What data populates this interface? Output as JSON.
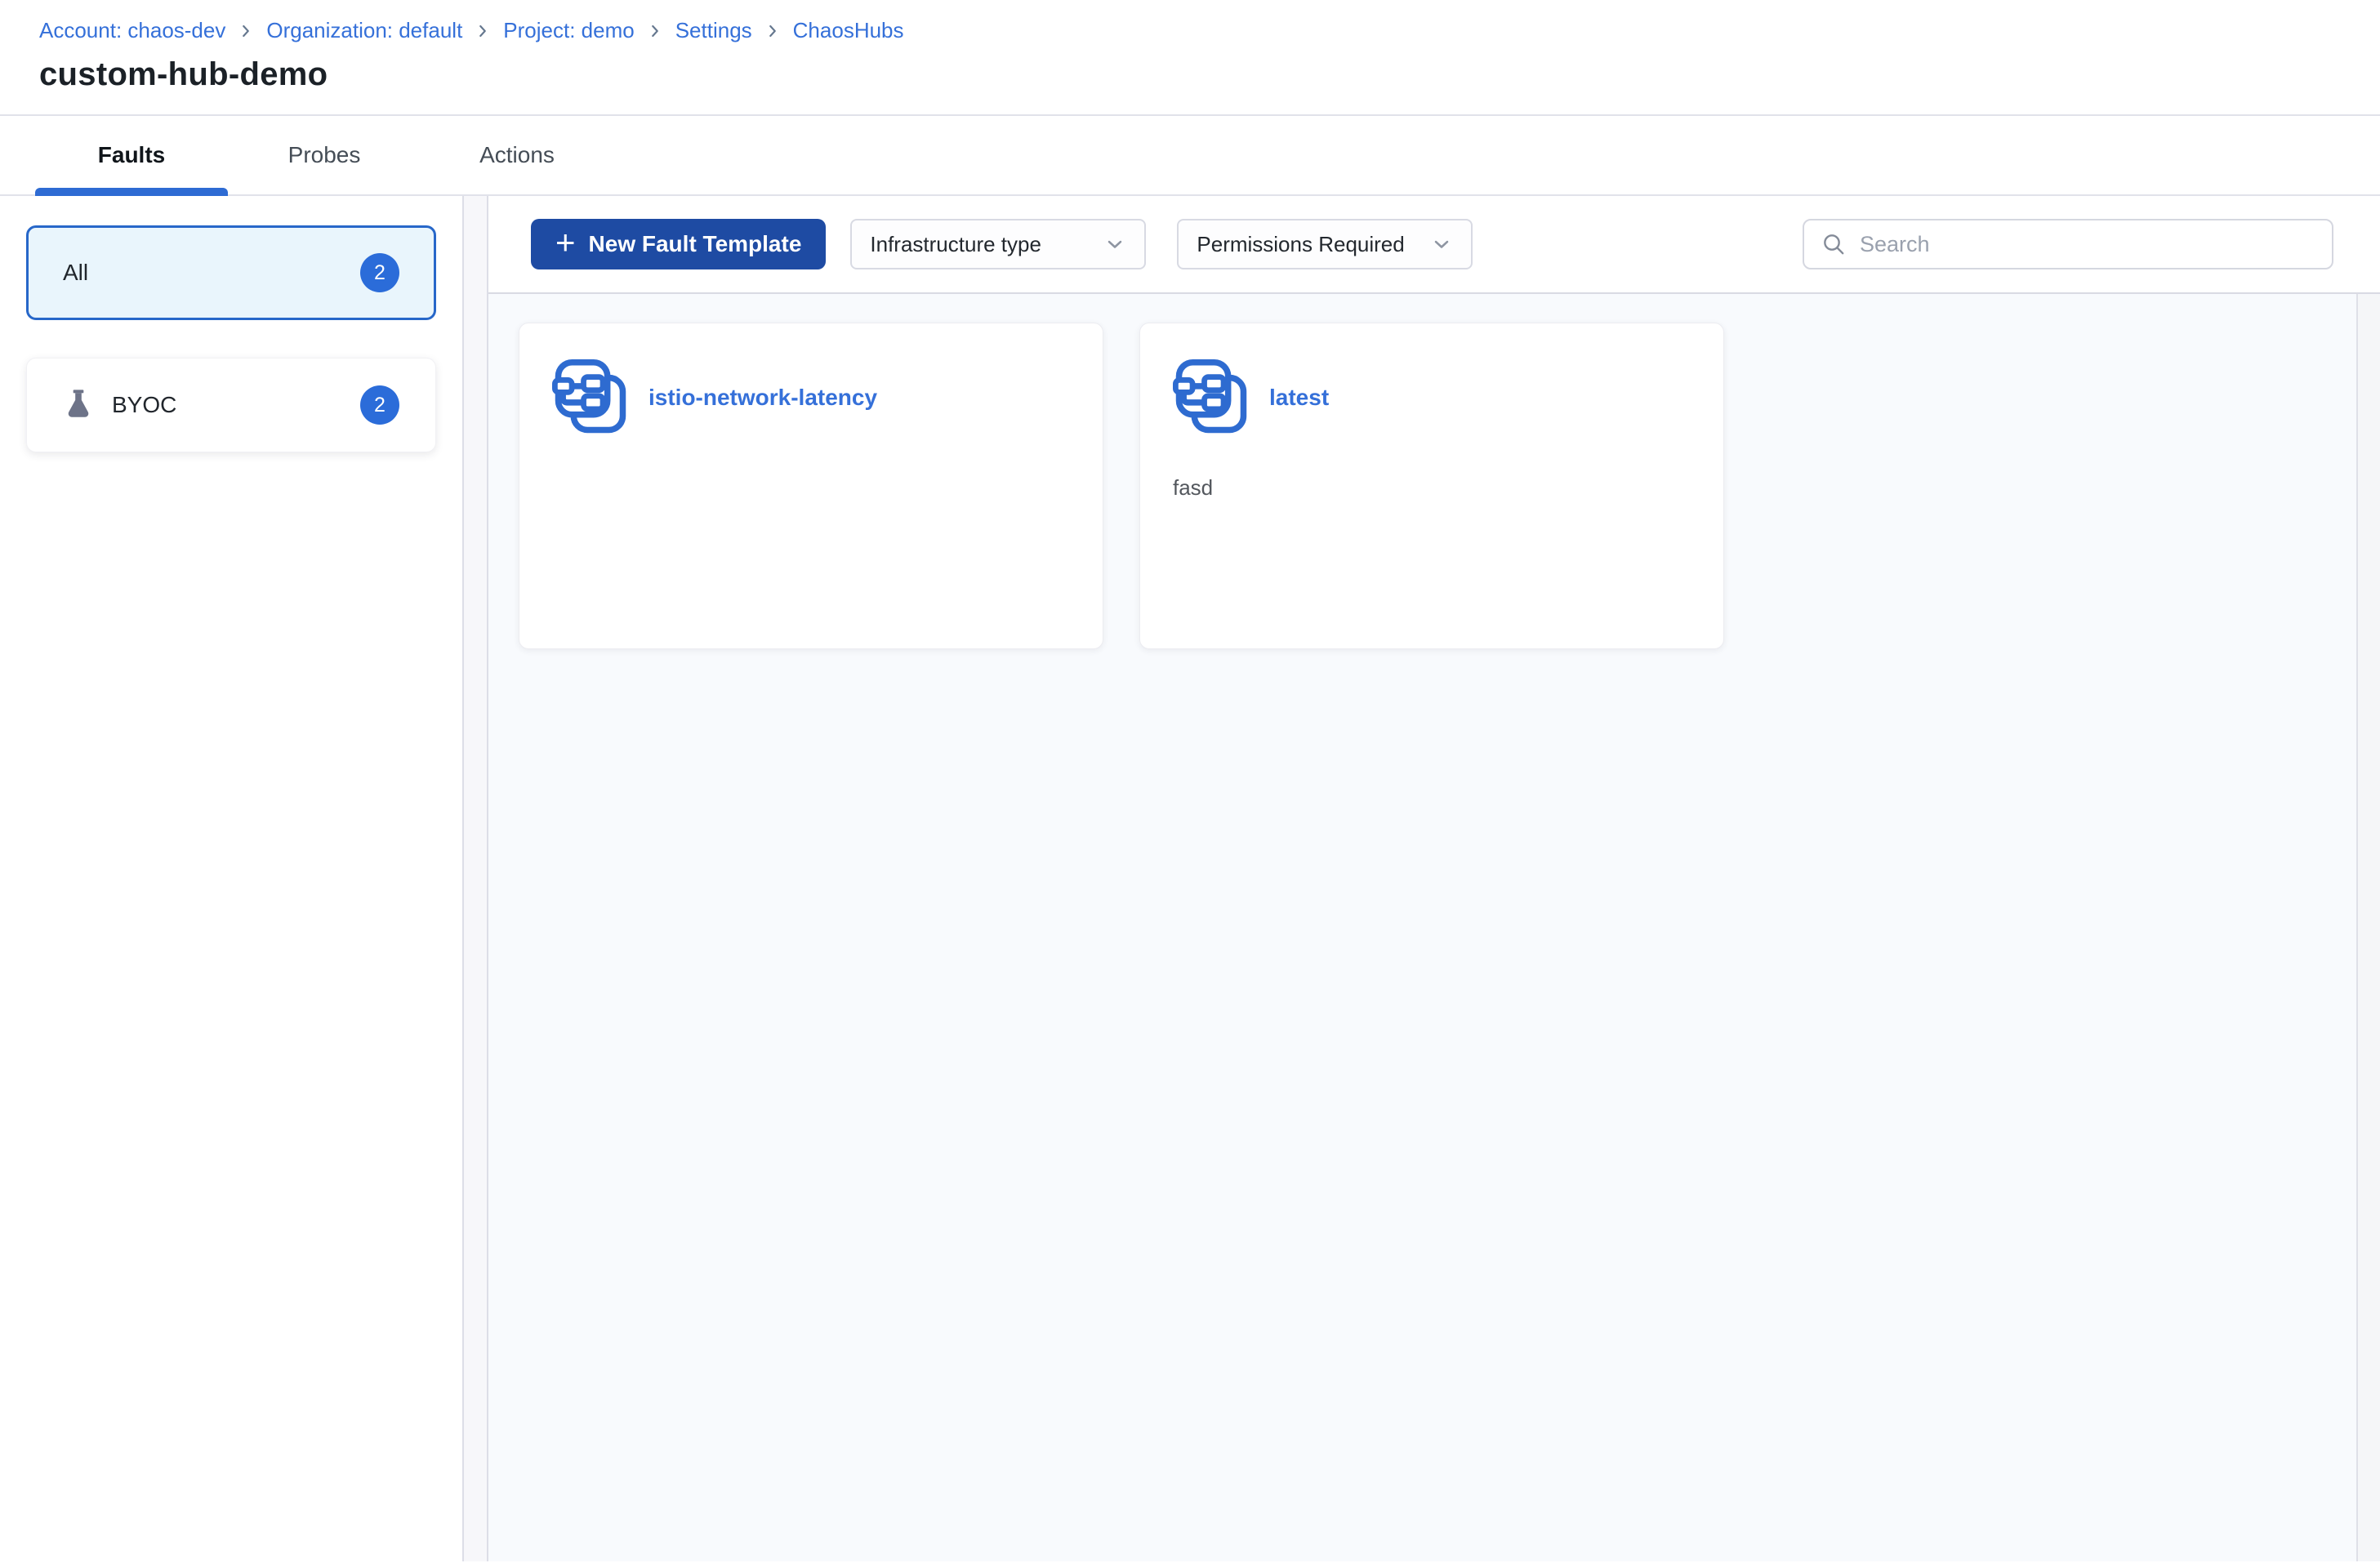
{
  "breadcrumb": {
    "items": [
      "Account: chaos-dev",
      "Organization: default",
      "Project: demo",
      "Settings",
      "ChaosHubs"
    ],
    "separator": "›"
  },
  "header": {
    "title": "custom-hub-demo"
  },
  "tabs": [
    {
      "label": "Faults",
      "active": true
    },
    {
      "label": "Probes",
      "active": false
    },
    {
      "label": "Actions",
      "active": false
    }
  ],
  "sidebar": {
    "filters": [
      {
        "label": "All",
        "count": "2",
        "selected": true,
        "icon": null
      },
      {
        "label": "BYOC",
        "count": "2",
        "selected": false,
        "icon": "flask-icon"
      }
    ]
  },
  "toolbar": {
    "new_template_button": "New Fault Template",
    "plus": "+",
    "filters": [
      {
        "label": "Infrastructure type"
      },
      {
        "label": "Permissions Required"
      }
    ],
    "search": {
      "placeholder": "Search",
      "value": ""
    }
  },
  "cards": [
    {
      "title": "istio-network-latency",
      "description": "",
      "icon": "fault-template-icon"
    },
    {
      "title": "latest",
      "description": "fasd",
      "icon": "fault-template-icon"
    }
  ],
  "colors": {
    "accent": "#2e6bd3",
    "primary_button": "#1e4ba3",
    "link": "#3570d9",
    "badge": "#2b6cd9",
    "selected_bg": "#e9f5fc",
    "selected_border": "#2767c9",
    "content_bg": "#f8fafd",
    "icon_blue": "#2e6bd0",
    "flask_gray": "#6d7388"
  }
}
